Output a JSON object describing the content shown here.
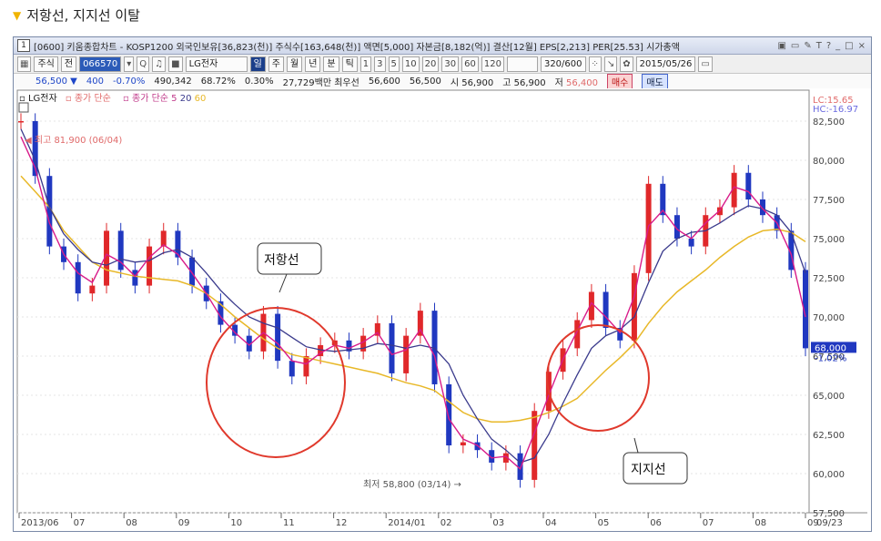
{
  "caption": {
    "marker": "▼",
    "text": "저항선, 지지선 이탈"
  },
  "window": {
    "number": "1",
    "title": "[0600] 키움종합차트 - KOSP1200 외국인보유[36,823(천)] 주식수[163,648(천)] 액면[5,000] 자본금[8,182(억)] 결산[12월] EPS[2,213] PER[25.53] 시가총액"
  },
  "toolbar": {
    "market": "주식",
    "all": "전",
    "code": "066570",
    "search_icon": "Q",
    "name": "LG전자",
    "periods": [
      "일",
      "주",
      "월",
      "년",
      "분",
      "틱"
    ],
    "numbers": [
      "1",
      "3",
      "5",
      "10",
      "20",
      "30",
      "60",
      "120"
    ],
    "count": "320/600",
    "date": "2015/05/26"
  },
  "quote": {
    "price": "56,500",
    "change": "400",
    "change_pct": "-0.70%",
    "volume": "490,342",
    "vol_ratio": "68.72%",
    "turnover": "0.30%",
    "amount": "27,729백만 최우선",
    "best_ask": "56,600",
    "best_bid": "56,500",
    "open_label": "시",
    "open": "56,900",
    "high_label": "고",
    "high": "56,900",
    "low_label": "저",
    "low": "56,400",
    "buy": "매수",
    "sell": "매도"
  },
  "legend": {
    "stock": "LG전자",
    "ma_label": "종가 단순",
    "ma2_label": "종가 단순 5",
    "ma_periods": [
      "20",
      "60"
    ]
  },
  "annotations": {
    "resistance": "저항선",
    "support": "지지선",
    "high": "최고 81,900 (06/04)",
    "low": "최저 58,800 (03/14)"
  },
  "right_labels": {
    "lc": "LC:15.65",
    "hc": "HC:-16.97",
    "last": "68,000",
    "last_pct": "-1.02%"
  },
  "colors": {
    "up": "#e0282a",
    "down": "#2038c0",
    "ma5": "#d81b8a",
    "ma20": "#3a3a8c",
    "ma60": "#e8b828",
    "circle": "#e0392c"
  },
  "chart_data": {
    "type": "candlestick",
    "yticks": [
      "82,500",
      "80,000",
      "77,500",
      "75,000",
      "72,500",
      "70,000",
      "67,500",
      "65,000",
      "62,500",
      "60,000",
      "57,500"
    ],
    "ylim": [
      57500,
      82500
    ],
    "xticks": [
      "2013/06",
      "07",
      "08",
      "09",
      "10",
      "11",
      "12",
      "2014/01",
      "02",
      "03",
      "04",
      "05",
      "06",
      "07",
      "08",
      "09",
      "09/23"
    ],
    "close": [
      82500,
      79000,
      74500,
      73500,
      71500,
      72000,
      75500,
      73000,
      72000,
      74500,
      75500,
      73800,
      72000,
      71000,
      69500,
      68800,
      67800,
      70200,
      67200,
      66200,
      67500,
      68200,
      68500,
      67800,
      68800,
      69600,
      66400,
      68800,
      70400,
      65700,
      61800,
      62000,
      61500,
      60700,
      61300,
      59600,
      64000,
      66500,
      68000,
      69800,
      71600,
      69300,
      68500,
      72800,
      78500,
      76500,
      75000,
      74500,
      76500,
      77000,
      79200,
      77500,
      76500,
      75500,
      73000,
      68000
    ],
    "ma5": [
      81500,
      79500,
      76000,
      74000,
      72800,
      72200,
      74000,
      73500,
      72600,
      73800,
      74600,
      74000,
      72800,
      71500,
      70000,
      69000,
      68200,
      69000,
      68300,
      67200,
      67000,
      67700,
      68200,
      68000,
      68400,
      69000,
      67600,
      67900,
      69200,
      67500,
      63500,
      62200,
      61800,
      61000,
      61100,
      60300,
      62600,
      65000,
      67300,
      69100,
      70900,
      70000,
      69000,
      71300,
      75800,
      76800,
      75600,
      75000,
      76000,
      76800,
      78300,
      78000,
      76900,
      76000,
      74000,
      70000
    ],
    "ma20": [
      82000,
      80000,
      77000,
      75300,
      74300,
      73500,
      73300,
      73700,
      73500,
      73600,
      74100,
      74300,
      73800,
      72800,
      71700,
      70800,
      70000,
      69600,
      69300,
      68700,
      68100,
      67900,
      67800,
      67900,
      68000,
      68300,
      68200,
      68000,
      68200,
      68000,
      67000,
      65000,
      63500,
      62200,
      61500,
      60700,
      61000,
      62500,
      64500,
      66300,
      68000,
      68800,
      69200,
      70000,
      72200,
      74200,
      75000,
      75400,
      75500,
      76000,
      76600,
      77100,
      76900,
      76500,
      75400,
      72800
    ],
    "ma60": [
      79000,
      78000,
      77000,
      75500,
      74500,
      73500,
      73000,
      72800,
      72600,
      72500,
      72400,
      72300,
      72000,
      71500,
      70800,
      70000,
      69300,
      68600,
      68000,
      67600,
      67400,
      67200,
      67000,
      66800,
      66600,
      66400,
      66100,
      65800,
      65600,
      65300,
      64600,
      63900,
      63500,
      63300,
      63300,
      63400,
      63600,
      63900,
      64300,
      64800,
      65700,
      66600,
      67400,
      68300,
      69600,
      70700,
      71600,
      72300,
      73000,
      73800,
      74500,
      75100,
      75500,
      75600,
      75400,
      74800
    ]
  }
}
